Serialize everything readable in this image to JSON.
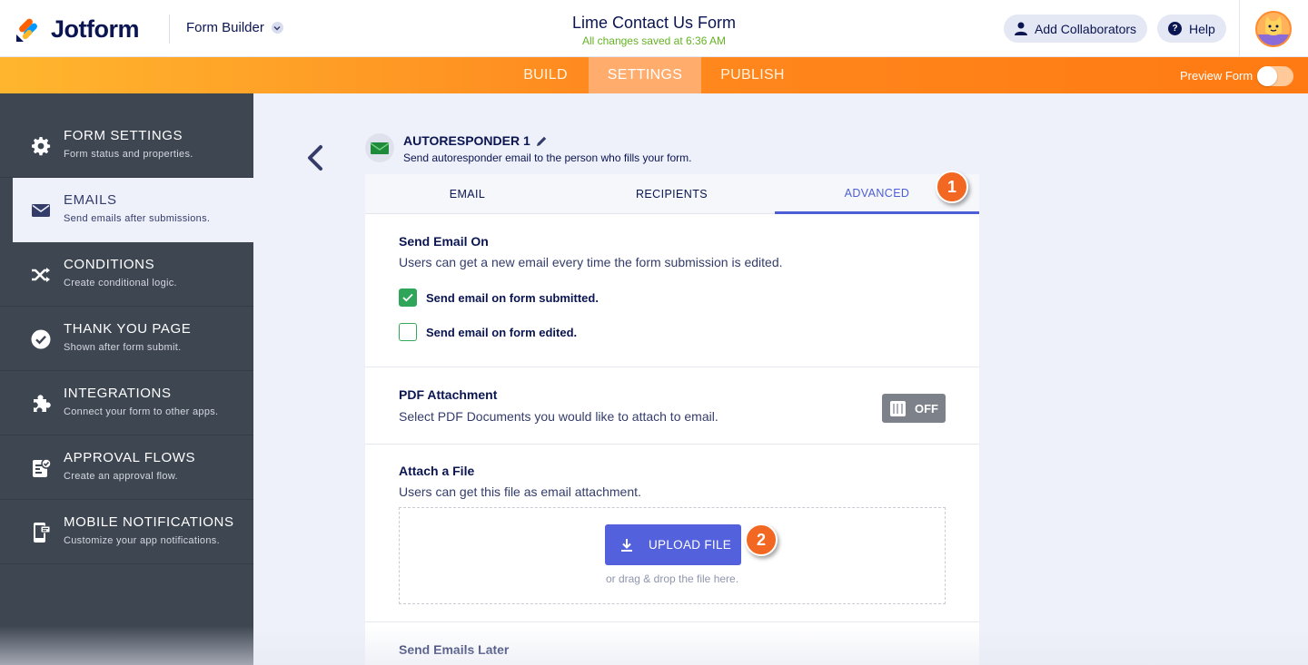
{
  "brand": {
    "name": "Jotform",
    "accent": "#ff7a12"
  },
  "header": {
    "builder_menu": "Form Builder",
    "form_title": "Lime Contact Us Form",
    "save_status": "All changes saved at 6:36 AM",
    "add_collaborators": "Add Collaborators",
    "help": "Help",
    "help_glyph": "?"
  },
  "nav": {
    "tabs": [
      {
        "label": "BUILD",
        "active": false
      },
      {
        "label": "SETTINGS",
        "active": true
      },
      {
        "label": "PUBLISH",
        "active": false
      }
    ],
    "preview_label": "Preview Form",
    "preview_enabled": false
  },
  "sidebar": {
    "items": [
      {
        "label": "FORM SETTINGS",
        "sub": "Form status and properties.",
        "icon": "gear-icon"
      },
      {
        "label": "EMAILS",
        "sub": "Send emails after submissions.",
        "icon": "envelope-icon",
        "active": true
      },
      {
        "label": "CONDITIONS",
        "sub": "Create conditional logic.",
        "icon": "shuffle-icon"
      },
      {
        "label": "THANK YOU PAGE",
        "sub": "Shown after form submit.",
        "icon": "check-circle-icon"
      },
      {
        "label": "INTEGRATIONS",
        "sub": "Connect your form to other apps.",
        "icon": "puzzle-icon"
      },
      {
        "label": "APPROVAL FLOWS",
        "sub": "Create an approval flow.",
        "icon": "approval-icon"
      },
      {
        "label": "MOBILE NOTIFICATIONS",
        "sub": "Customize your app notifications.",
        "icon": "mobile-icon"
      }
    ]
  },
  "panel": {
    "title": "AUTORESPONDER 1",
    "description": "Send autoresponder email to the person who fills your form.",
    "tabs": [
      {
        "label": "EMAIL",
        "active": false
      },
      {
        "label": "RECIPIENTS",
        "active": false
      },
      {
        "label": "ADVANCED",
        "active": true
      }
    ],
    "sections": {
      "send_on": {
        "title": "Send Email On",
        "description": "Users can get a new email every time the form submission is edited.",
        "options": [
          {
            "label": "Send email on form submitted.",
            "checked": true
          },
          {
            "label": "Send email on form edited.",
            "checked": false
          }
        ]
      },
      "pdf": {
        "title": "PDF Attachment",
        "description": "Select PDF Documents you would like to attach to email.",
        "toggle_label": "OFF",
        "enabled": false
      },
      "attach": {
        "title": "Attach a File",
        "description": "Users can get this file as email attachment.",
        "upload_label": "UPLOAD FILE",
        "drop_hint": "or drag & drop the file here."
      },
      "later": {
        "title": "Send Emails Later"
      }
    }
  },
  "annotations": {
    "badge_1": "1",
    "badge_2": "2"
  }
}
